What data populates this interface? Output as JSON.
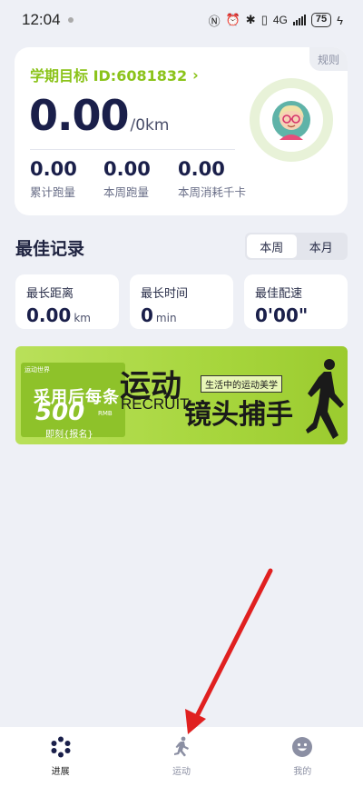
{
  "status_bar": {
    "time": "12:04",
    "network": "4G",
    "battery": "75"
  },
  "goal_card": {
    "rule_tag": "规则",
    "title": "学期目标 ID:6081832",
    "value": "0.00",
    "unit": "/0km",
    "stats": [
      {
        "value": "0.00",
        "label": "累计跑量"
      },
      {
        "value": "0.00",
        "label": "本周跑量"
      },
      {
        "value": "0.00",
        "label": "本周消耗千卡"
      }
    ]
  },
  "best_records": {
    "title": "最佳记录",
    "tabs": [
      {
        "label": "本周",
        "active": true
      },
      {
        "label": "本月",
        "active": false
      }
    ],
    "cards": [
      {
        "label": "最长距离",
        "value": "0.00",
        "unit": "km"
      },
      {
        "label": "最长时间",
        "value": "0",
        "unit": "min"
      },
      {
        "label": "最佳配速",
        "value": "0'00\"",
        "unit": ""
      }
    ]
  },
  "banner": {
    "brand": "运动世界",
    "promo": "采用后每条",
    "amount": "500",
    "currency": "RMB",
    "join": "即刻{报名}",
    "headline1": "运动",
    "recruit": "RECRUIT",
    "tag": "生活中的运动美学",
    "headline2": "镜头捕手",
    "bg_color": "#a7d63d"
  },
  "bottom_nav": {
    "items": [
      {
        "label": "进展",
        "icon": "progress-icon",
        "active": true
      },
      {
        "label": "运动",
        "icon": "runner-icon",
        "active": false
      },
      {
        "label": "我的",
        "icon": "smiley-icon",
        "active": false
      }
    ]
  },
  "colors": {
    "accent_green": "#8bc31a",
    "annotation_red": "#e02020"
  }
}
